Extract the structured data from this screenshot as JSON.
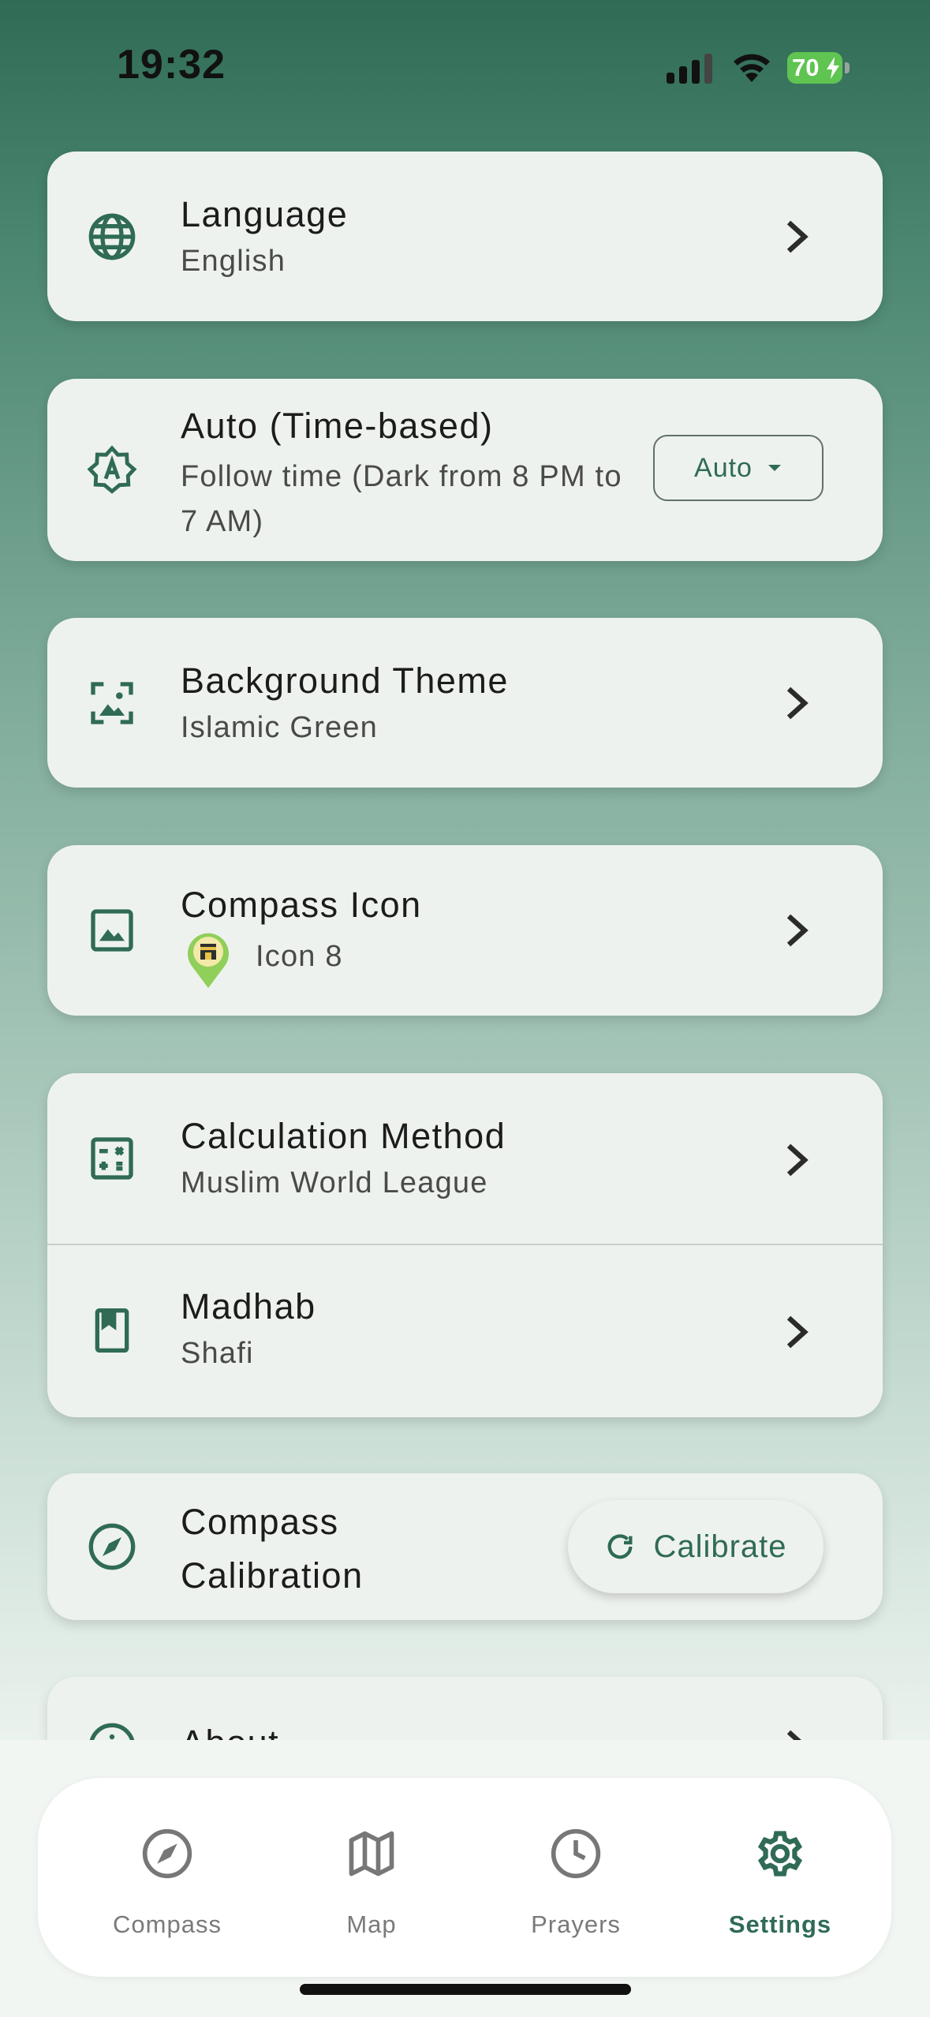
{
  "status": {
    "time": "19:32",
    "battery": "70"
  },
  "settings": {
    "language": {
      "title": "Language",
      "value": "English"
    },
    "appearance": {
      "title": "Auto (Time-based)",
      "subtitle": "Follow time (Dark from 8 PM to 7 AM)",
      "dropdown_value": "Auto"
    },
    "background_theme": {
      "title": "Background Theme",
      "value": "Islamic Green"
    },
    "compass_icon": {
      "title": "Compass Icon",
      "value": "Icon 8"
    },
    "calculation_method": {
      "title": "Calculation Method",
      "value": "Muslim World League"
    },
    "madhab": {
      "title": "Madhab",
      "value": "Shafi"
    },
    "compass_calibration": {
      "title_line1": "Compass",
      "title_line2": "Calibration",
      "button_label": "Calibrate"
    },
    "about": {
      "title": "About"
    }
  },
  "tabs": [
    {
      "label": "Compass",
      "icon": "compass-icon",
      "active": false
    },
    {
      "label": "Map",
      "icon": "map-icon",
      "active": false
    },
    {
      "label": "Prayers",
      "icon": "clock-icon",
      "active": false
    },
    {
      "label": "Settings",
      "icon": "gear-icon",
      "active": true
    }
  ],
  "colors": {
    "accent": "#2f6b55",
    "card": "#eef2ee",
    "battery": "#5fc451"
  }
}
